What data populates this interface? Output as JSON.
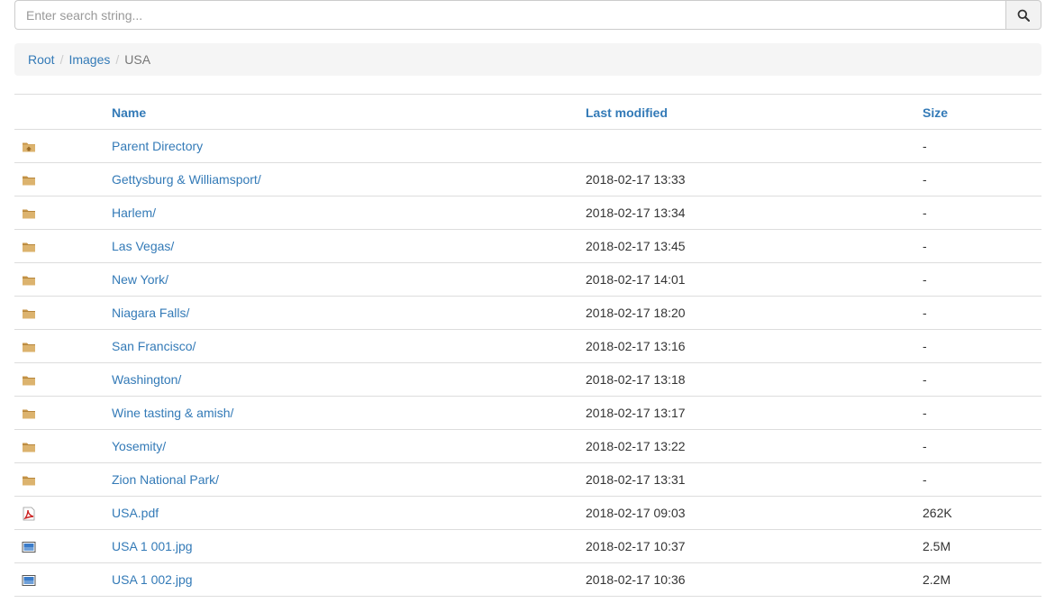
{
  "search": {
    "placeholder": "Enter search string...",
    "value": ""
  },
  "breadcrumb": {
    "items": [
      "Root",
      "Images"
    ],
    "current": "USA"
  },
  "table": {
    "headers": {
      "name": "Name",
      "modified": "Last modified",
      "size": "Size"
    },
    "rows": [
      {
        "icon": "parent-folder-icon",
        "name": "Parent Directory",
        "modified": "",
        "size": "-"
      },
      {
        "icon": "folder-icon",
        "name": "Gettysburg & Williamsport/",
        "modified": "2018-02-17 13:33",
        "size": "-"
      },
      {
        "icon": "folder-icon",
        "name": "Harlem/",
        "modified": "2018-02-17 13:34",
        "size": "-"
      },
      {
        "icon": "folder-icon",
        "name": "Las Vegas/",
        "modified": "2018-02-17 13:45",
        "size": "-"
      },
      {
        "icon": "folder-icon",
        "name": "New York/",
        "modified": "2018-02-17 14:01",
        "size": "-"
      },
      {
        "icon": "folder-icon",
        "name": "Niagara Falls/",
        "modified": "2018-02-17 18:20",
        "size": "-"
      },
      {
        "icon": "folder-icon",
        "name": "San Francisco/",
        "modified": "2018-02-17 13:16",
        "size": "-"
      },
      {
        "icon": "folder-icon",
        "name": "Washington/",
        "modified": "2018-02-17 13:18",
        "size": "-"
      },
      {
        "icon": "folder-icon",
        "name": "Wine tasting & amish/",
        "modified": "2018-02-17 13:17",
        "size": "-"
      },
      {
        "icon": "folder-icon",
        "name": "Yosemity/",
        "modified": "2018-02-17 13:22",
        "size": "-"
      },
      {
        "icon": "folder-icon",
        "name": "Zion National Park/",
        "modified": "2018-02-17 13:31",
        "size": "-"
      },
      {
        "icon": "pdf-icon",
        "name": "USA.pdf",
        "modified": "2018-02-17 09:03",
        "size": "262K"
      },
      {
        "icon": "image-icon",
        "name": "USA 1 001.jpg",
        "modified": "2018-02-17 10:37",
        "size": "2.5M"
      },
      {
        "icon": "image-icon",
        "name": "USA 1 002.jpg",
        "modified": "2018-02-17 10:36",
        "size": "2.2M"
      }
    ]
  },
  "colors": {
    "link": "#337ab7",
    "folder": "#d7a95a",
    "pdf": "#cc2222"
  }
}
